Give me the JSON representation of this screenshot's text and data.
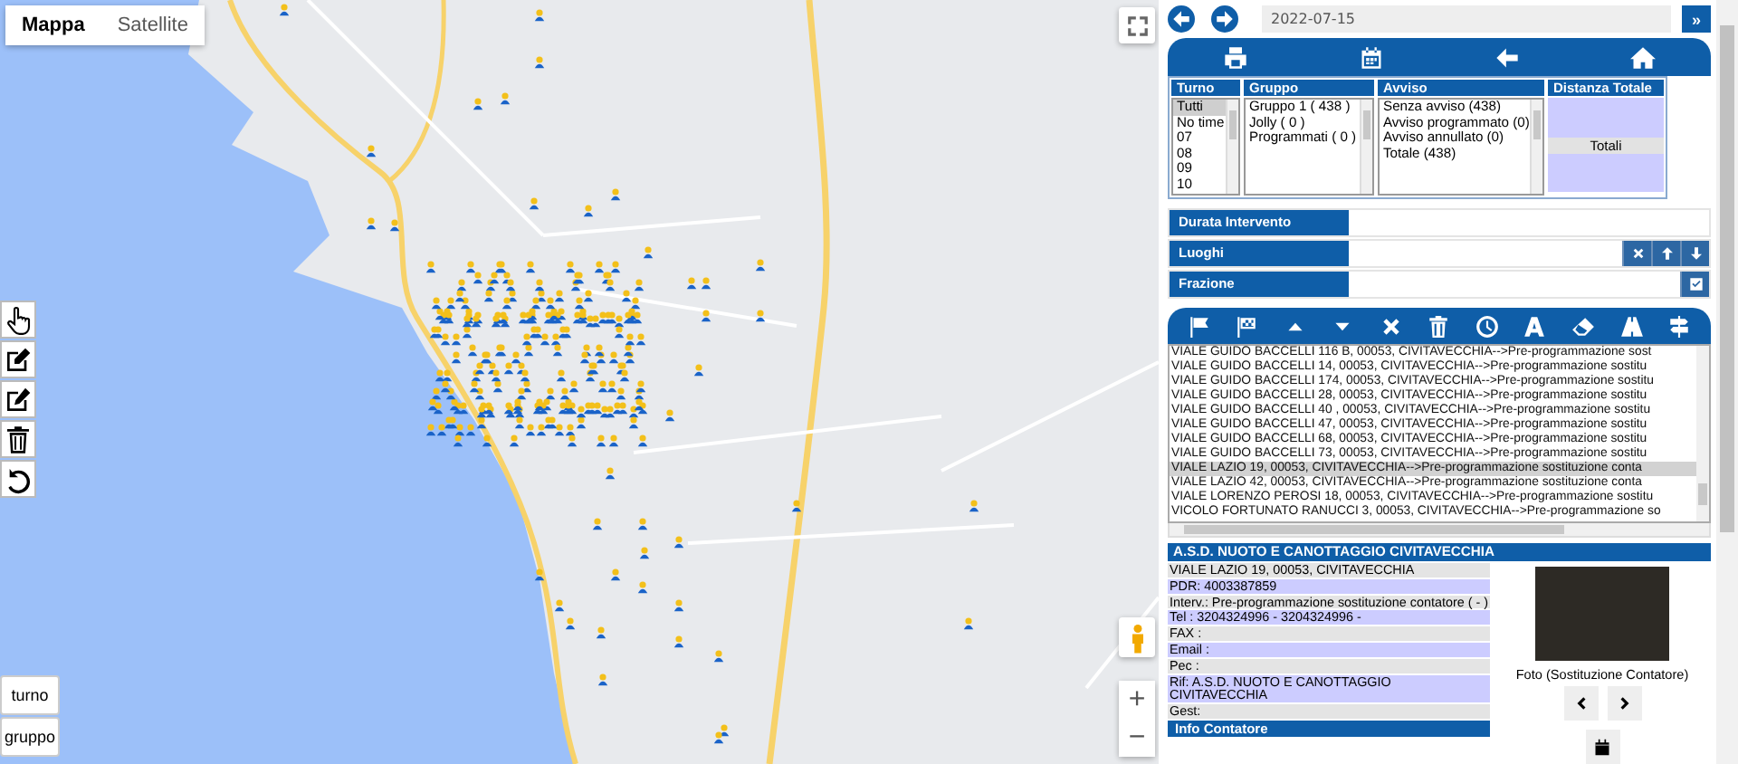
{
  "map": {
    "map_types": [
      {
        "label": "Mappa",
        "selected": true
      },
      {
        "label": "Satellite",
        "selected": false
      }
    ],
    "draw_tools": [
      {
        "kind": "pointer"
      },
      {
        "kind": "edit"
      },
      {
        "kind": "pencil"
      },
      {
        "kind": "trash"
      },
      {
        "kind": "undo"
      }
    ],
    "layer_buttons": [
      "turno",
      "gruppo"
    ],
    "zoom": {
      "in": "+",
      "out": "−"
    }
  },
  "date_bar": {
    "value": "2022-07-15",
    "expand": "»"
  },
  "filters": [
    {
      "header": "Turno",
      "options": [
        {
          "label": "Tutti",
          "selected": true
        },
        {
          "label": "No time",
          "selected": false
        },
        {
          "label": "07",
          "selected": false
        },
        {
          "label": "08",
          "selected": false
        },
        {
          "label": "09",
          "selected": false
        },
        {
          "label": "10",
          "selected": false
        }
      ]
    },
    {
      "header": "Gruppo",
      "options": [
        {
          "label": "Gruppo 1 ( 438 )",
          "selected": false
        },
        {
          "label": "Jolly ( 0 )",
          "selected": false
        },
        {
          "label": "Programmati ( 0 )",
          "selected": false
        }
      ]
    },
    {
      "header": "Avviso",
      "options": [
        {
          "label": "Senza avviso (438)",
          "selected": false
        },
        {
          "label": "Avviso programmato (0)",
          "selected": false
        },
        {
          "label": "Avviso annullato (0)",
          "selected": false
        },
        {
          "label": "Totale (438)",
          "selected": false
        }
      ]
    }
  ],
  "distance": {
    "header": "Distanza Totale",
    "total_label": "Totali"
  },
  "fields": [
    {
      "label": "Durata Intervento",
      "kind": "plain"
    },
    {
      "label": "Luoghi",
      "kind": "reorder"
    },
    {
      "label": "Frazione",
      "kind": "toggle"
    }
  ],
  "route_list": [
    {
      "text": "VIALE GUIDO BACCELLI 116 B, 00053, CIVITAVECCHIA-->Pre-programmazione sost",
      "selected": false
    },
    {
      "text": "VIALE GUIDO BACCELLI 14, 00053, CIVITAVECCHIA-->Pre-programmazione sostitu",
      "selected": false
    },
    {
      "text": "VIALE GUIDO BACCELLI 174, 00053, CIVITAVECCHIA-->Pre-programmazione sostitu",
      "selected": false
    },
    {
      "text": "VIALE GUIDO BACCELLI 28, 00053, CIVITAVECCHIA-->Pre-programmazione sostitu",
      "selected": false
    },
    {
      "text": "VIALE GUIDO BACCELLI 40 , 00053, CIVITAVECCHIA-->Pre-programmazione sostitu",
      "selected": false
    },
    {
      "text": "VIALE GUIDO BACCELLI 47, 00053, CIVITAVECCHIA-->Pre-programmazione sostitu",
      "selected": false
    },
    {
      "text": "VIALE GUIDO BACCELLI 68, 00053, CIVITAVECCHIA-->Pre-programmazione sostitu",
      "selected": false
    },
    {
      "text": "VIALE GUIDO BACCELLI 73, 00053, CIVITAVECCHIA-->Pre-programmazione sostitu",
      "selected": false
    },
    {
      "text": "VIALE LAZIO 19, 00053, CIVITAVECCHIA-->Pre-programmazione sostituzione conta",
      "selected": true
    },
    {
      "text": "VIALE LAZIO 42, 00053, CIVITAVECCHIA-->Pre-programmazione sostituzione conta",
      "selected": false
    },
    {
      "text": "VIALE LORENZO PEROSI 18, 00053, CIVITAVECCHIA-->Pre-programmazione sostitu",
      "selected": false
    },
    {
      "text": "VICOLO FORTUNATO RANUCCI 3, 00053, CIVITAVECCHIA-->Pre-programmazione so",
      "selected": false
    }
  ],
  "detail": {
    "title": "A.S.D. NUOTO E CANOTTAGGIO CIVITAVECCHIA",
    "lines": [
      "VIALE LAZIO 19, 00053, CIVITAVECCHIA",
      "PDR: 4003387859",
      "Interv.: Pre-programmazione sostituzione contatore ( - )",
      "Tel : 3204324996 - 3204324996 -",
      "FAX :",
      "Email :",
      "Pec :",
      "Rif: A.S.D. NUOTO E CANOTTAGGIO CIVITAVECCHIA",
      "Gest:"
    ],
    "photo_caption": "Foto (Sostituzione Contatore)",
    "section": "Info Contatore"
  }
}
